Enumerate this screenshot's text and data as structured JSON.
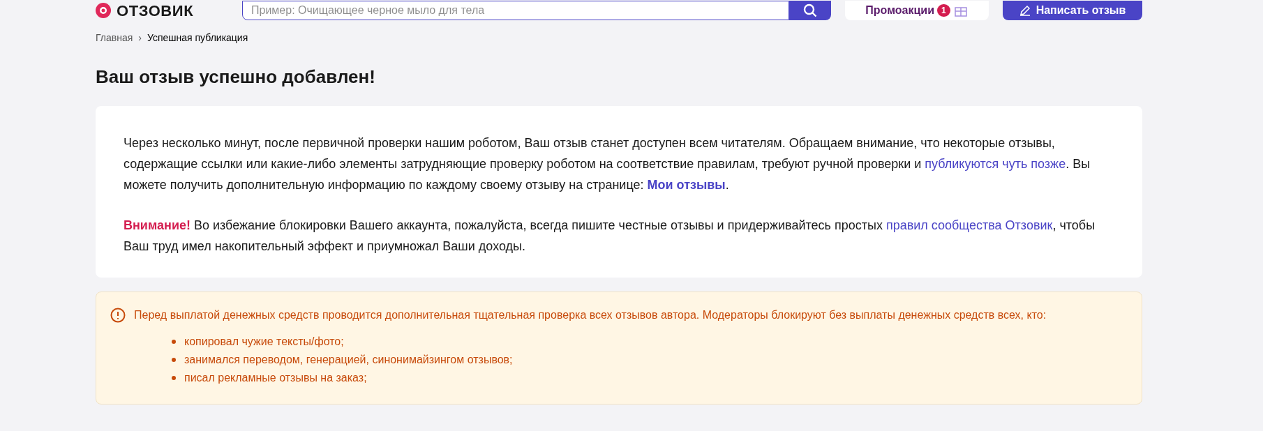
{
  "header": {
    "logo": "ОТЗОВИК",
    "search": {
      "placeholder": "Пример: Очищающее черное мыло для тела"
    },
    "promo": {
      "label": "Промоакции",
      "count": "1"
    },
    "write_button": "Написать отзыв"
  },
  "breadcrumbs": [
    {
      "label": "Главная",
      "current": false
    },
    {
      "label": "Успешная публикация",
      "current": true
    }
  ],
  "breadcrumb_separator": "›",
  "title": "Ваш отзыв успешно добавлен!",
  "paragraphs": [
    [
      {
        "kind": "text",
        "text": "Через несколько минут, после первичной проверки нашим роботом, Ваш отзыв станет доступен всем читателям. Обращаем внимание, что некоторые отзывы, содержащие ссылки или какие-либо элементы затрудняющие проверку роботом на соответствие правилам, требуют ручной проверки и "
      },
      {
        "kind": "link",
        "text": "публикуются чуть позже"
      },
      {
        "kind": "text",
        "text": ". Вы можете получить дополнительную информацию по каждому своему отзыву на странице: "
      },
      {
        "kind": "strong-link",
        "text": "Мои отзывы"
      },
      {
        "kind": "text",
        "text": "."
      }
    ],
    [
      {
        "kind": "alert",
        "text": "Внимание!"
      },
      {
        "kind": "text",
        "text": " Во избежание блокировки Вашего аккаунта, пожалуйста, всегда пишите честные отзывы и придерживайтесь простых "
      },
      {
        "kind": "link",
        "text": "правил сообщества Отзовик"
      },
      {
        "kind": "text",
        "text": ", чтобы Ваш труд имел накопительный эффект и приумножал Ваши доходы."
      }
    ]
  ],
  "warning": {
    "text": "Перед выплатой денежных средств проводится дополнительная тщательная проверка всех отзывов автора. Модераторы блокируют без выплаты денежных средств всех, кто:",
    "items": [
      "копировал чужие тексты/фото;",
      "занимался переводом, генерацией, синонимайзингом отзывов;",
      "писал рекламные отзывы на заказ;"
    ]
  }
}
